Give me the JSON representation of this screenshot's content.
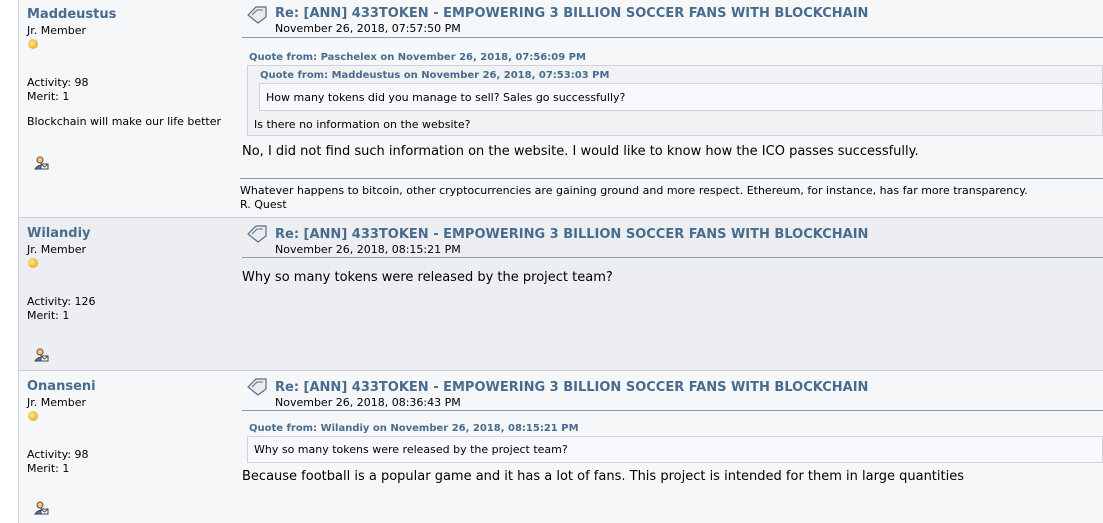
{
  "posts": [
    {
      "author": "Maddeustus",
      "rank": "Jr. Member",
      "activity": "Activity: 98",
      "merit": "Merit: 1",
      "personal_text": "Blockchain will make our life better",
      "subject": "Re: [ANN] 433TOKEN - EMPOWERING 3 BILLION SOCCER FANS WITH BLOCKCHAIN",
      "date": "November 26, 2018, 07:57:50 PM",
      "quote": {
        "header": "Quote from: Paschelex on November 26, 2018, 07:56:09 PM",
        "nested": {
          "header": "Quote from: Maddeustus on November 26, 2018, 07:53:03 PM",
          "text": "How many tokens did you manage to sell? Sales go successfully?"
        },
        "text": "Is there no information on the website?"
      },
      "body": "No, I did not find such information on the website. I would like to know how the ICO passes successfully.",
      "signature_line1": "Whatever happens to bitcoin, other cryptocurrencies are gaining ground and more respect. Ethereum, for instance, has far more transparency.",
      "signature_line2": "R. Quest"
    },
    {
      "author": "Wilandiy",
      "rank": "Jr. Member",
      "activity": "Activity: 126",
      "merit": "Merit: 1",
      "subject": "Re: [ANN] 433TOKEN - EMPOWERING 3 BILLION SOCCER FANS WITH BLOCKCHAIN",
      "date": "November 26, 2018, 08:15:21 PM",
      "body": "Why so many tokens were released by the project team?"
    },
    {
      "author": "Onanseni",
      "rank": "Jr. Member",
      "activity": "Activity: 98",
      "merit": "Merit: 1",
      "subject": "Re: [ANN] 433TOKEN - EMPOWERING 3 BILLION SOCCER FANS WITH BLOCKCHAIN",
      "date": "November 26, 2018, 08:36:43 PM",
      "quote": {
        "header": "Quote from: Wilandiy on November 26, 2018, 08:15:21 PM",
        "text": "Why so many tokens were released by the project team?"
      },
      "body": "Because football is a popular game and it has a lot of fans. This project is intended for them in large quantities"
    }
  ]
}
